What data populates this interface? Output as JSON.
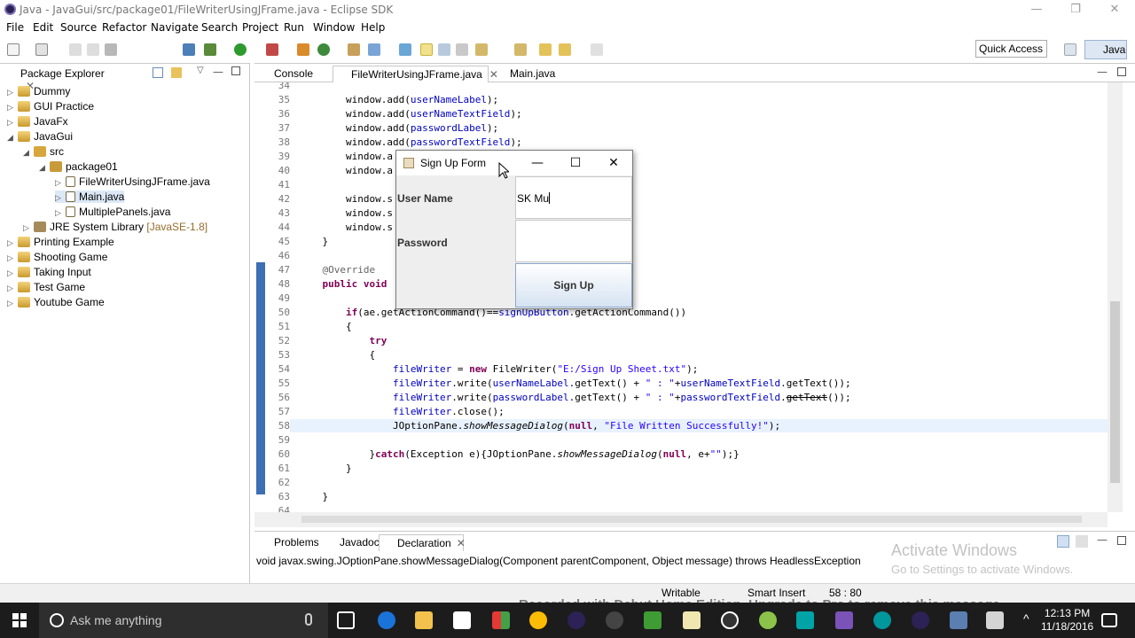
{
  "window": {
    "title": "Java - JavaGui/src/package01/FileWriterUsingJFrame.java - Eclipse SDK",
    "minimize": "—",
    "restore": "❐",
    "close": "✕"
  },
  "menu": [
    "File",
    "Edit",
    "Source",
    "Refactor",
    "Navigate",
    "Search",
    "Project",
    "Run",
    "Window",
    "Help"
  ],
  "toolbar": {
    "quick_access": "Quick Access",
    "perspective": "Java"
  },
  "package_explorer": {
    "tab": "Package Explorer",
    "items": [
      {
        "label": "Dummy",
        "extra": ""
      },
      {
        "label": "GUI Practice",
        "extra": ""
      },
      {
        "label": "JavaFx",
        "extra": ""
      },
      {
        "label": "JavaGui",
        "extra": ""
      },
      {
        "label": "src",
        "extra": ""
      },
      {
        "label": "package01",
        "extra": ""
      },
      {
        "label": "FileWriterUsingJFrame.java",
        "extra": ""
      },
      {
        "label": "Main.java",
        "extra": ""
      },
      {
        "label": "MultiplePanels.java",
        "extra": ""
      },
      {
        "label": "JRE System Library",
        "extra": "[JavaSE-1.8]"
      },
      {
        "label": "Printing Example",
        "extra": ""
      },
      {
        "label": "Shooting Game",
        "extra": ""
      },
      {
        "label": "Taking Input",
        "extra": ""
      },
      {
        "label": "Test Game",
        "extra": ""
      },
      {
        "label": "Youtube Game",
        "extra": ""
      }
    ]
  },
  "editor_tabs": [
    "Console",
    "FileWriterUsingJFrame.java",
    "Main.java"
  ],
  "editor": {
    "line_numbers": [
      "34",
      "35",
      "36",
      "37",
      "38",
      "39",
      "40",
      "41",
      "42",
      "43",
      "44",
      "45",
      "46",
      "47",
      "48",
      "49",
      "50",
      "51",
      "52",
      "53",
      "54",
      "55",
      "56",
      "57",
      "58",
      "59",
      "60",
      "61",
      "62",
      "63",
      "64"
    ]
  },
  "bottom_tabs": [
    "Problems",
    "Javadoc",
    "Declaration"
  ],
  "declaration": "void javax.swing.JOptionPane.showMessageDialog(Component parentComponent, Object message) throws HeadlessException",
  "status": {
    "writable": "Writable",
    "insert_mode": "Smart Insert",
    "position": "58 : 80"
  },
  "watermark": {
    "line1": "Activate Windows",
    "line2": "Go to Settings to activate Windows.",
    "recorder": "Recorded with Debut Home Edition. Upgrade to Pro to remove this message"
  },
  "dialog": {
    "title": "Sign Up Form",
    "minimize": "—",
    "maximize": "☐",
    "close": "✕",
    "username_label": "User Name",
    "username_value": "SK Mu",
    "password_label": "Password",
    "password_value": "",
    "button": "Sign Up"
  },
  "taskbar": {
    "search_placeholder": "Ask me anything",
    "time": "12:13 PM",
    "date": "11/18/2016"
  }
}
